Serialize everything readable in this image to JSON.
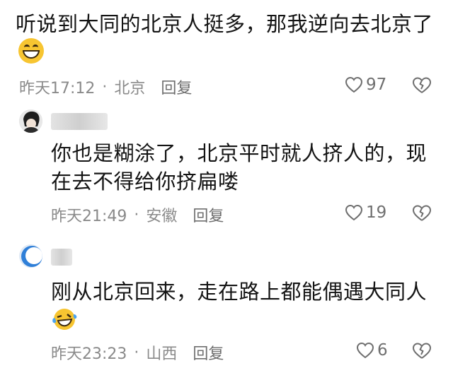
{
  "comments": [
    {
      "text": "听说到大同的北京人挺多，那我逆向去北京了",
      "emoji": "grinning-face-emoji",
      "time": "昨天17:12",
      "location": "北京",
      "reply": "回复",
      "likes": "97"
    },
    {
      "text": "你也是糊涂了，北京平时就人挤人的，现在去不得给你挤扁喽",
      "time": "昨天21:49",
      "location": "安徽",
      "reply": "回复",
      "likes": "19"
    },
    {
      "text": "刚从北京回来，走在路上都能偶遇大同人",
      "emoji": "laughing-tears-emoji",
      "time": "昨天23:23",
      "location": "山西",
      "reply": "回复",
      "likes": "6"
    }
  ],
  "separator": "·"
}
